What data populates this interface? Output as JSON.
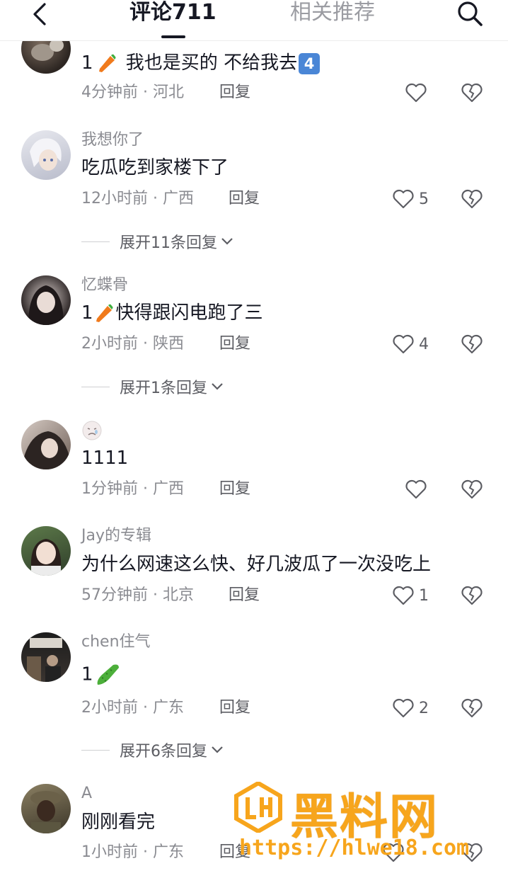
{
  "header": {
    "tab_comments": "评论711",
    "tab_related": "相关推荐",
    "back_icon": "chevron-left-icon",
    "search_icon": "search-icon"
  },
  "comments": [
    {
      "username": "",
      "text_prefix": "1",
      "text_body": " 我也是买的 不给我去",
      "time": "4分钟前",
      "location": "河北",
      "reply": "回复",
      "likes": ""
    },
    {
      "username": "我想你了",
      "text_body": "吃瓜吃到家楼下了",
      "time": "12小时前",
      "location": "广西",
      "reply": "回复",
      "likes": "5",
      "expand": "展开11条回复"
    },
    {
      "username": "忆蝶骨",
      "text_prefix": "1",
      "text_body": "快得跟闪电跑了三",
      "time": "2小时前",
      "location": "陕西",
      "reply": "回复",
      "likes": "4",
      "expand": "展开1条回复"
    },
    {
      "username": "",
      "text_body": "1111",
      "time": "1分钟前",
      "location": "广西",
      "reply": "回复",
      "likes": ""
    },
    {
      "username": "Jay的专辑",
      "text_body": "为什么网速这么快、好几波瓜了一次没吃上",
      "time": "57分钟前",
      "location": "北京",
      "reply": "回复",
      "likes": "1"
    },
    {
      "username": "chen住气",
      "text_prefix": "1",
      "text_body": "",
      "time": "2小时前",
      "location": "广东",
      "reply": "回复",
      "likes": "2",
      "expand": "展开6条回复"
    },
    {
      "username": "A",
      "text_body": "刚刚看完",
      "time": "1小时前",
      "location": "广东",
      "reply": "回复",
      "likes": ""
    }
  ],
  "separator": " · ",
  "watermark": {
    "title": "黑料网",
    "url": "https://hlwe18.com"
  },
  "colors": {
    "text": "#161823",
    "muted": "#8a8b91",
    "accent_watermark": "#f7a51c"
  }
}
